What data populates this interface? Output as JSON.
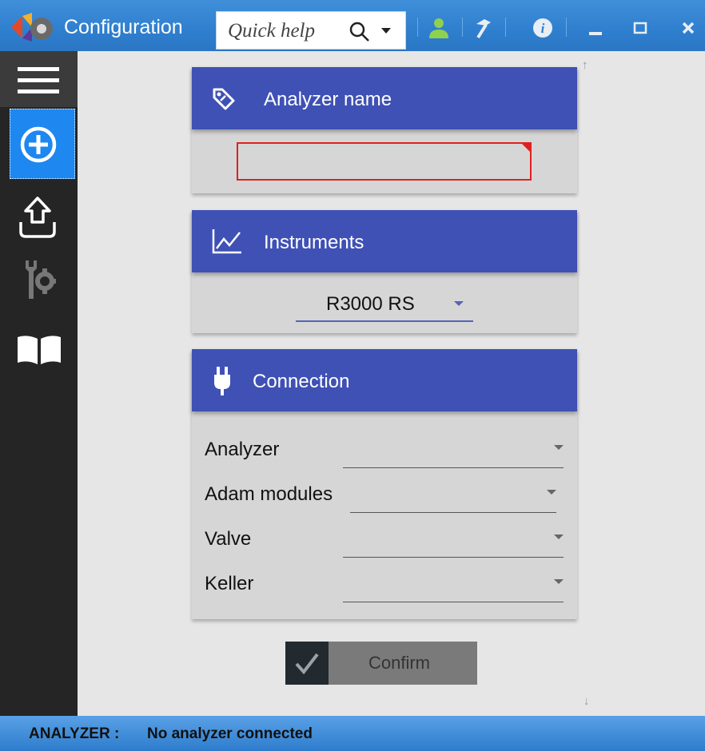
{
  "titlebar": {
    "title": "Configuration",
    "quick_help_placeholder": "Quick help",
    "icons": [
      "app-logo-icon",
      "search-icon",
      "caret-down-icon",
      "user-icon",
      "hammer-icon",
      "info-icon",
      "minimize-icon",
      "maximize-icon",
      "close-icon"
    ]
  },
  "sidebar": {
    "items": [
      {
        "name": "menu",
        "icon": "hamburger-icon"
      },
      {
        "name": "add",
        "icon": "plus-circle-icon",
        "active": true
      },
      {
        "name": "upload",
        "icon": "upload-icon"
      },
      {
        "name": "settings",
        "icon": "wrench-gear-icon"
      },
      {
        "name": "manual",
        "icon": "book-icon"
      }
    ]
  },
  "cards": {
    "analyzer_name": {
      "title": "Analyzer name",
      "value": ""
    },
    "instruments": {
      "title": "Instruments",
      "selected": "R3000 RS"
    },
    "connection": {
      "title": "Connection",
      "rows": [
        {
          "label": "Analyzer",
          "value": ""
        },
        {
          "label": "Adam modules",
          "value": ""
        },
        {
          "label": "Valve",
          "value": ""
        },
        {
          "label": "Keller",
          "value": ""
        }
      ]
    }
  },
  "confirm": {
    "label": "Confirm"
  },
  "status": {
    "key": "ANALYZER :",
    "value": "No analyzer connected"
  },
  "colors": {
    "accent": "#3f51b5",
    "sidebar": "#252525",
    "active": "#1e87f0",
    "error": "#e02020"
  }
}
